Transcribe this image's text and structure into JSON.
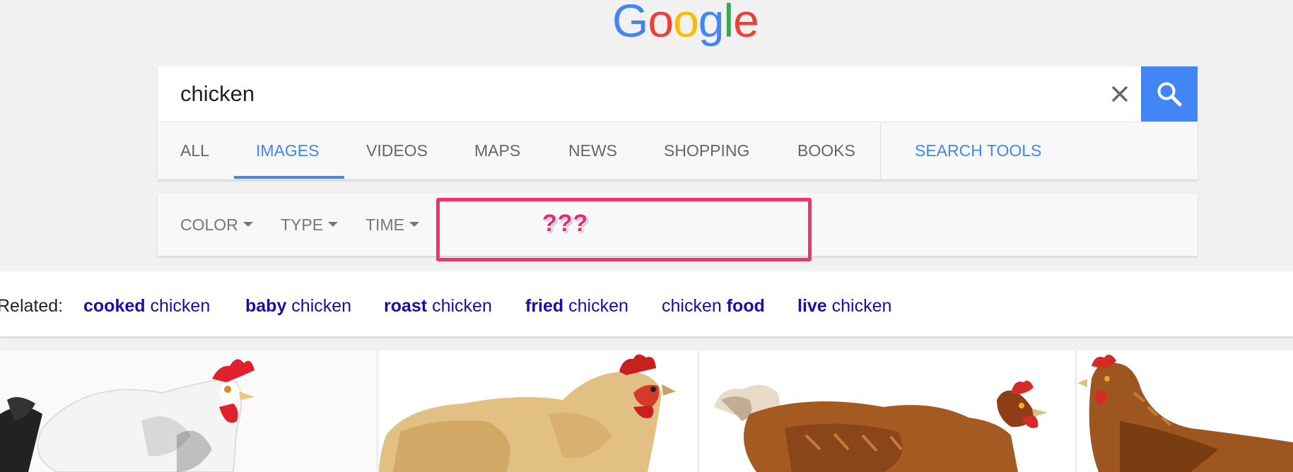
{
  "logo": {
    "letters": [
      "G",
      "o",
      "o",
      "g",
      "l",
      "e"
    ],
    "colors": [
      "#4285f4",
      "#ea4335",
      "#fbbc05",
      "#4285f4",
      "#34a853",
      "#ea4335"
    ]
  },
  "search": {
    "query": "chicken",
    "clear_icon": "close-icon",
    "submit_icon": "search-icon"
  },
  "tabs": [
    {
      "label": "ALL",
      "active": false
    },
    {
      "label": "IMAGES",
      "active": true
    },
    {
      "label": "VIDEOS",
      "active": false
    },
    {
      "label": "MAPS",
      "active": false
    },
    {
      "label": "NEWS",
      "active": false
    },
    {
      "label": "SHOPPING",
      "active": false
    },
    {
      "label": "BOOKS",
      "active": false
    }
  ],
  "search_tools_label": "SEARCH TOOLS",
  "tools": [
    {
      "label": "COLOR"
    },
    {
      "label": "TYPE"
    },
    {
      "label": "TIME"
    }
  ],
  "annotation": {
    "text": "???",
    "box_color": "#f0336c"
  },
  "related": {
    "label": "Related:",
    "items": [
      {
        "bold": "cooked",
        "normal": " chicken",
        "bold_first": true
      },
      {
        "bold": "baby",
        "normal": " chicken",
        "bold_first": true
      },
      {
        "bold": "roast",
        "normal": " chicken",
        "bold_first": true
      },
      {
        "bold": "fried",
        "normal": " chicken",
        "bold_first": true
      },
      {
        "normal": "chicken ",
        "bold": "food",
        "bold_first": false
      },
      {
        "bold": "live",
        "normal": " chicken",
        "bold_first": true
      }
    ]
  },
  "images": [
    {
      "name": "white-chicken-image"
    },
    {
      "name": "buff-chicken-image"
    },
    {
      "name": "brown-hen-image"
    },
    {
      "name": "brown-hen-image-2"
    }
  ],
  "colors": {
    "accent": "#4285f4",
    "link": "#1a0dab"
  }
}
